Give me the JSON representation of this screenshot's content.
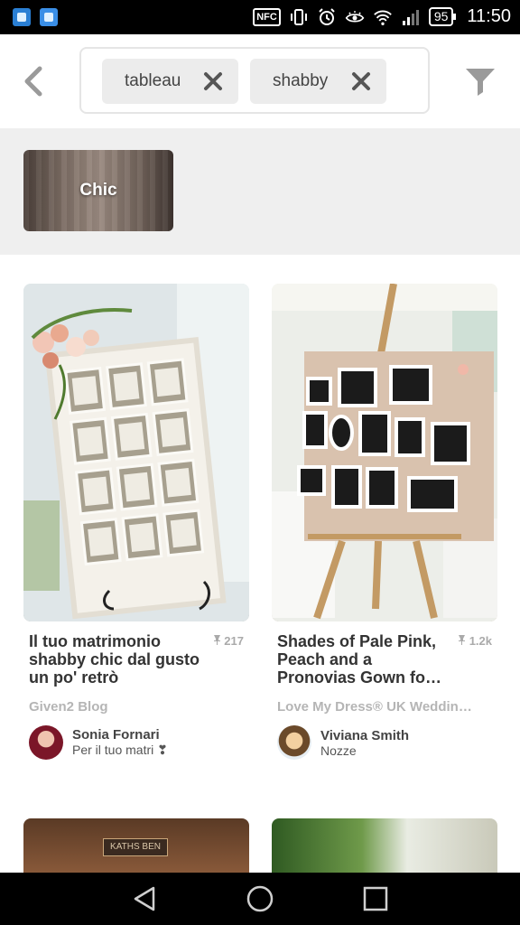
{
  "status_bar": {
    "nfc": "NFC",
    "battery": "95",
    "time": "11:50"
  },
  "search": {
    "chips": [
      {
        "label": "tableau"
      },
      {
        "label": "shabby"
      }
    ]
  },
  "suggestions": [
    {
      "label": "Chic"
    }
  ],
  "pins": [
    {
      "title": "Il tuo matrimonio shabby chic dal gusto un po' retrò",
      "pin_count": "217",
      "source": "Given2 Blog",
      "user": "Sonia Fornari",
      "board": "Per il tuo matri ❣"
    },
    {
      "title": "Shades of Pale Pink, Peach and a Pronovias Gown fo…",
      "pin_count": "1.2k",
      "source": "Love My Dress® UK Weddin…",
      "user": "Viviana Smith",
      "board": "Nozze"
    }
  ],
  "peek": {
    "sign_text": "KATHS BEN"
  },
  "colors": {
    "chip_bg": "#ececec",
    "suggest_bg": "#efefef",
    "muted_text": "#b5b5b5"
  }
}
